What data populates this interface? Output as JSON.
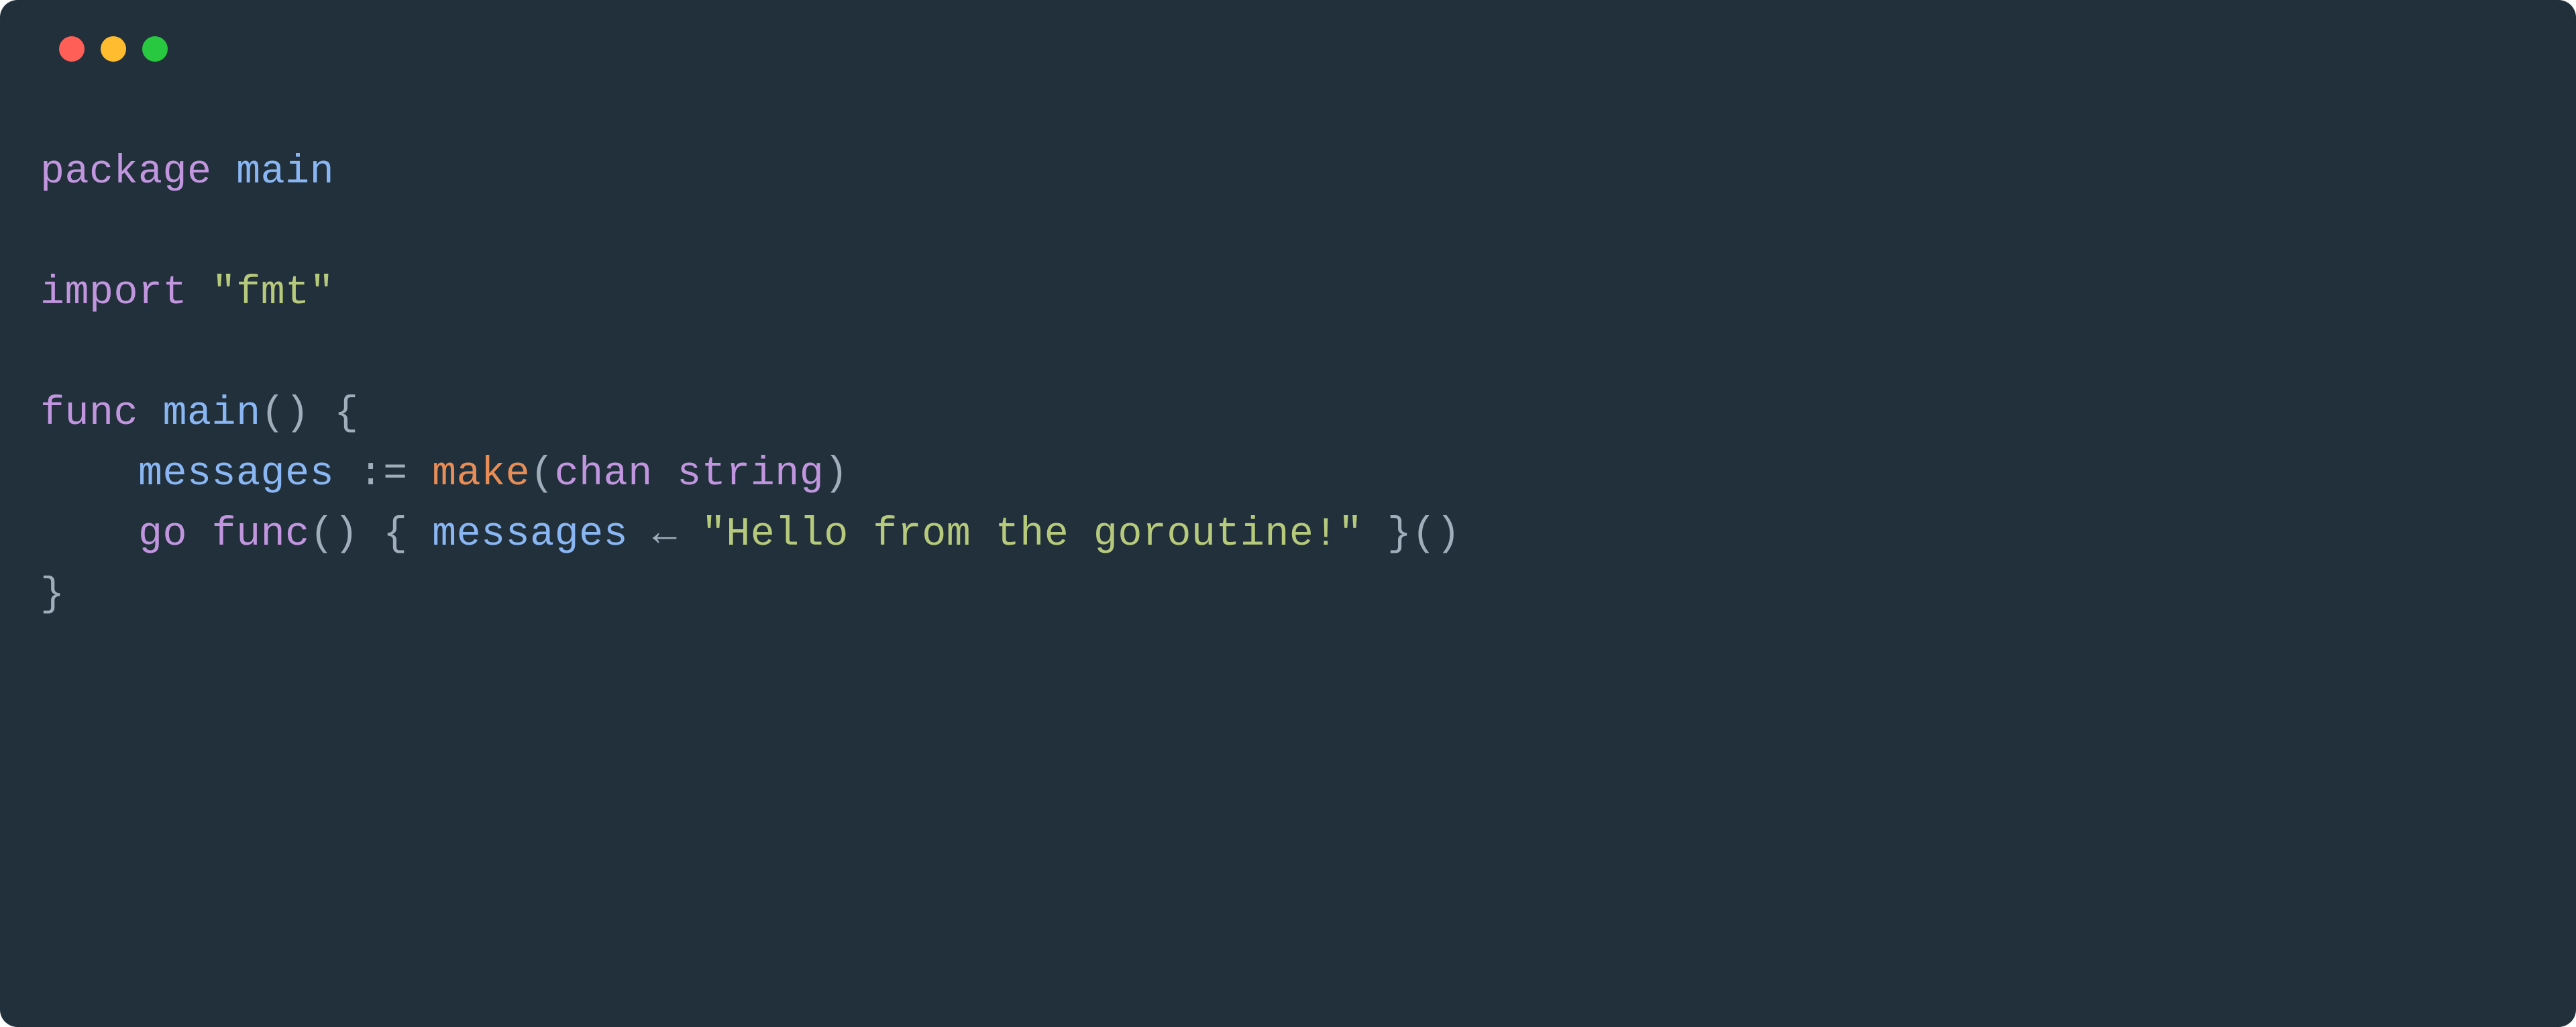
{
  "window": {
    "controls": [
      "close",
      "minimize",
      "maximize"
    ]
  },
  "code": {
    "lines": [
      [
        {
          "cls": "tok-keyword",
          "t": "package"
        },
        {
          "cls": "tok-default",
          "t": " "
        },
        {
          "cls": "tok-ident",
          "t": "main"
        }
      ],
      [],
      [
        {
          "cls": "tok-keyword",
          "t": "import"
        },
        {
          "cls": "tok-default",
          "t": " "
        },
        {
          "cls": "tok-string",
          "t": "\"fmt\""
        }
      ],
      [],
      [
        {
          "cls": "tok-keyword",
          "t": "func"
        },
        {
          "cls": "tok-default",
          "t": " "
        },
        {
          "cls": "tok-ident",
          "t": "main"
        },
        {
          "cls": "tok-punct",
          "t": "() {"
        }
      ],
      [
        {
          "cls": "tok-default",
          "t": "    "
        },
        {
          "cls": "tok-ident",
          "t": "messages"
        },
        {
          "cls": "tok-default",
          "t": " "
        },
        {
          "cls": "tok-op",
          "t": ":="
        },
        {
          "cls": "tok-default",
          "t": " "
        },
        {
          "cls": "tok-builtin",
          "t": "make"
        },
        {
          "cls": "tok-punct",
          "t": "("
        },
        {
          "cls": "tok-keyword",
          "t": "chan"
        },
        {
          "cls": "tok-default",
          "t": " "
        },
        {
          "cls": "tok-keyword",
          "t": "string"
        },
        {
          "cls": "tok-punct",
          "t": ")"
        }
      ],
      [
        {
          "cls": "tok-default",
          "t": "    "
        },
        {
          "cls": "tok-keyword",
          "t": "go"
        },
        {
          "cls": "tok-default",
          "t": " "
        },
        {
          "cls": "tok-keyword",
          "t": "func"
        },
        {
          "cls": "tok-punct",
          "t": "() { "
        },
        {
          "cls": "tok-ident",
          "t": "messages"
        },
        {
          "cls": "tok-default",
          "t": " "
        },
        {
          "cls": "tok-op",
          "t": "←"
        },
        {
          "cls": "tok-default",
          "t": " "
        },
        {
          "cls": "tok-string",
          "t": "\"Hello from the goroutine!\""
        },
        {
          "cls": "tok-punct",
          "t": " }()"
        }
      ],
      [
        {
          "cls": "tok-punct",
          "t": "}"
        }
      ]
    ]
  }
}
